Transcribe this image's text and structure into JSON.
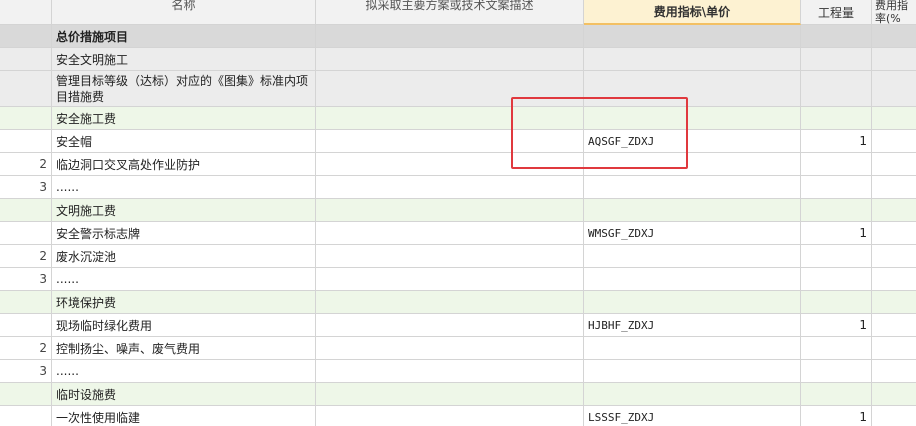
{
  "header": {
    "col_name": "名称",
    "col_desc": "拟采取主要方案或技术文案描述",
    "col_code": "费用指标\\单价",
    "col_qty": "工程量",
    "col_rate_line1": "费用指",
    "col_rate_line2": "率(%"
  },
  "rows": [
    {
      "kind": "group",
      "idx": "",
      "name": "总价措施项目",
      "code": "",
      "qty": ""
    },
    {
      "kind": "cat",
      "idx": "",
      "name": "安全文明施工",
      "code": "",
      "qty": ""
    },
    {
      "kind": "cat",
      "idx": "",
      "name": "管理目标等级（达标）对应的《图集》标准内项目措施费",
      "code": "",
      "qty": ""
    },
    {
      "kind": "sub",
      "idx": "",
      "name": "安全施工费",
      "code": "",
      "qty": ""
    },
    {
      "kind": "item",
      "idx": "",
      "name": "安全帽",
      "code": "AQSGF_ZDXJ",
      "qty": "1"
    },
    {
      "kind": "item",
      "idx": "2",
      "name": "临边洞口交叉高处作业防护",
      "code": "",
      "qty": ""
    },
    {
      "kind": "item",
      "idx": "3",
      "name": "......",
      "code": "",
      "qty": ""
    },
    {
      "kind": "sub",
      "idx": "",
      "name": "文明施工费",
      "code": "",
      "qty": ""
    },
    {
      "kind": "item",
      "idx": "",
      "name": "安全警示标志牌",
      "code": "WMSGF_ZDXJ",
      "qty": "1"
    },
    {
      "kind": "item",
      "idx": "2",
      "name": "废水沉淀池",
      "code": "",
      "qty": ""
    },
    {
      "kind": "item",
      "idx": "3",
      "name": "......",
      "code": "",
      "qty": ""
    },
    {
      "kind": "sub",
      "idx": "",
      "name": "环境保护费",
      "code": "",
      "qty": ""
    },
    {
      "kind": "item",
      "idx": "",
      "name": "现场临时绿化费用",
      "code": "HJBHF_ZDXJ",
      "qty": "1"
    },
    {
      "kind": "item",
      "idx": "2",
      "name": "控制扬尘、噪声、废气费用",
      "code": "",
      "qty": ""
    },
    {
      "kind": "item",
      "idx": "3",
      "name": "......",
      "code": "",
      "qty": ""
    },
    {
      "kind": "sub",
      "idx": "",
      "name": "临时设施费",
      "code": "",
      "qty": ""
    },
    {
      "kind": "item",
      "idx": "",
      "name": "一次性使用临建",
      "code": "LSSSF_ZDXJ",
      "qty": "1"
    }
  ]
}
